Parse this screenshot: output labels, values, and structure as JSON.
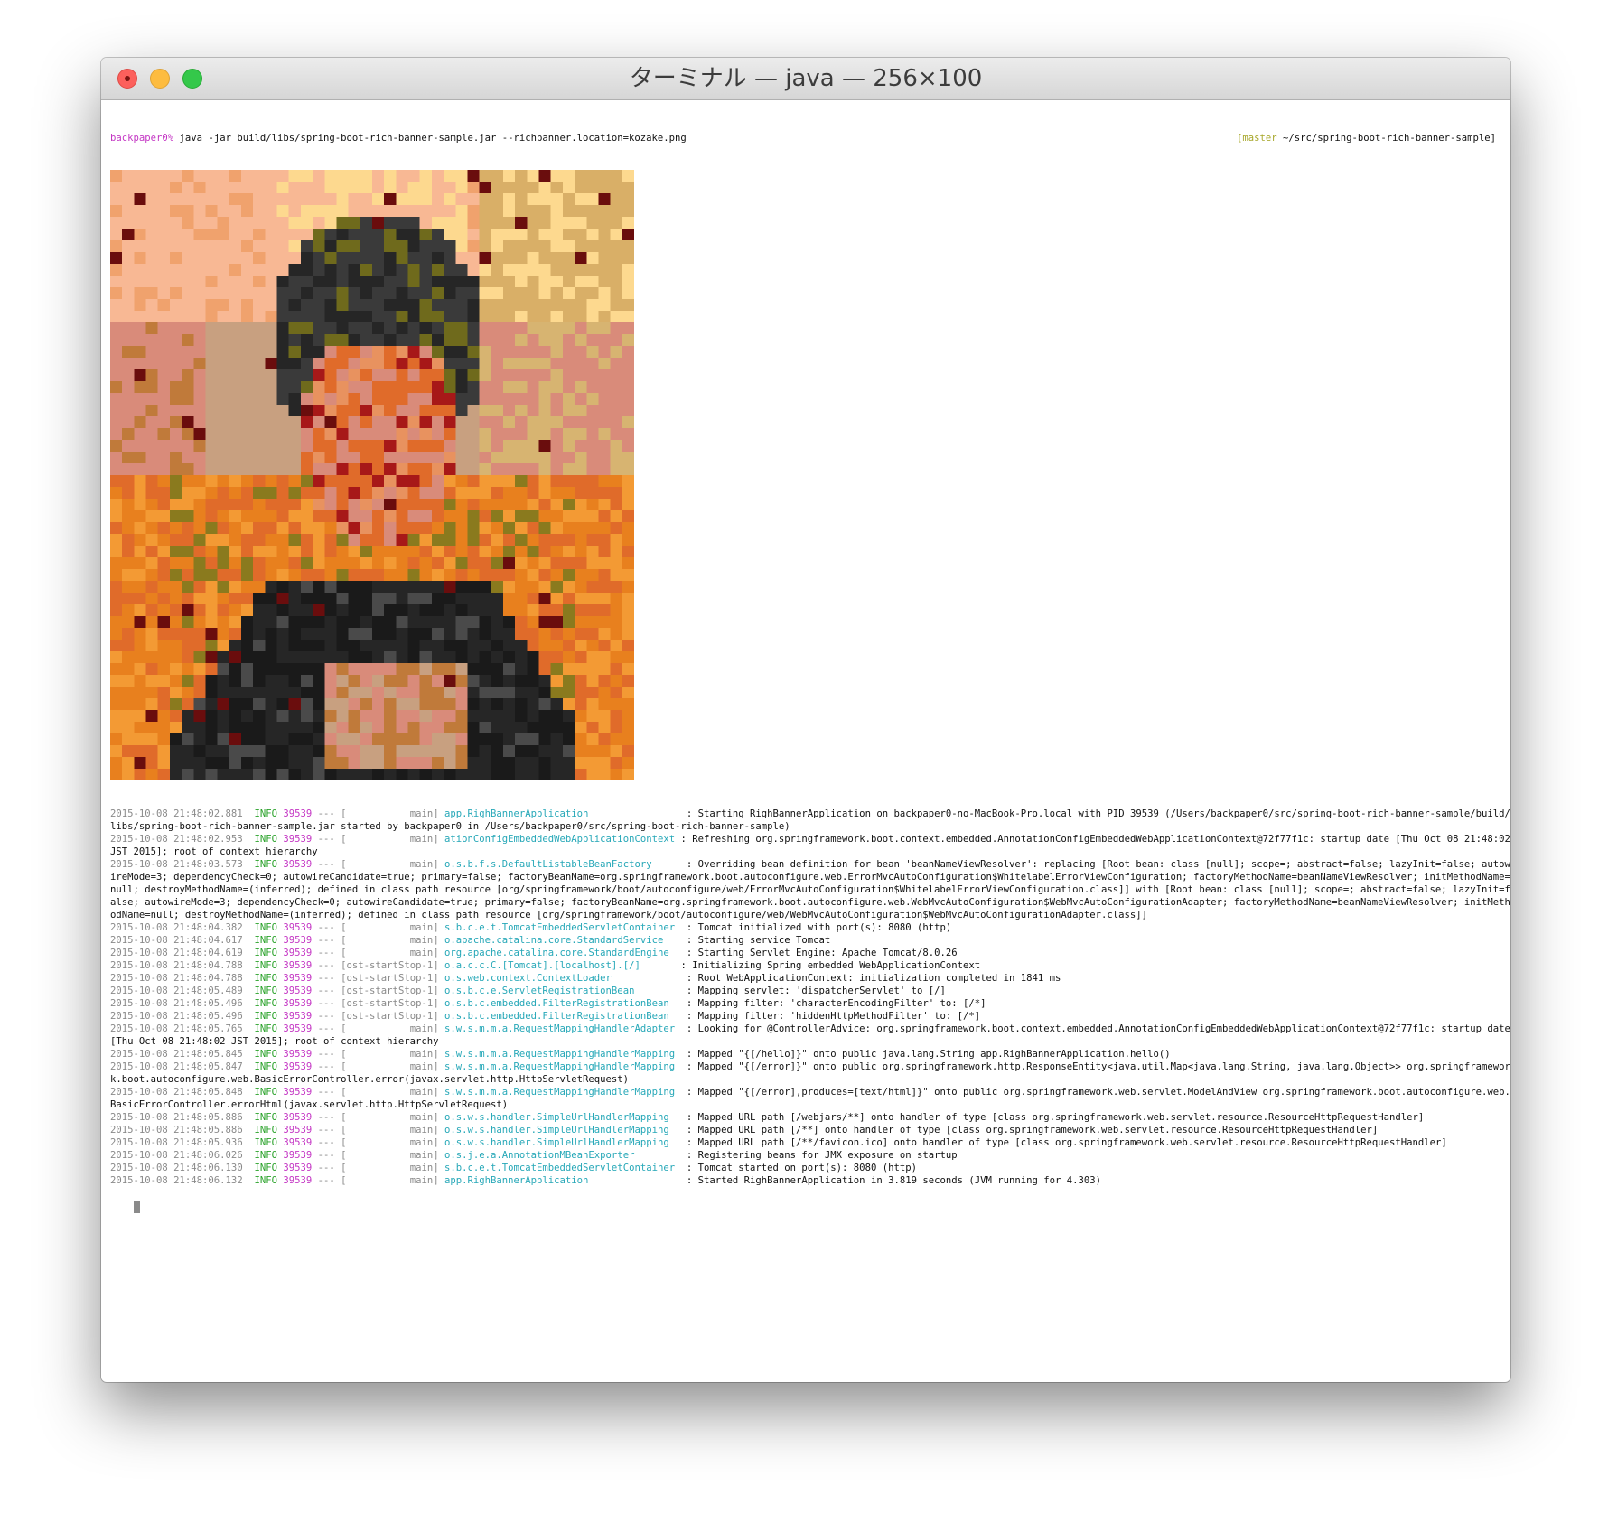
{
  "window": {
    "title": "ターミナル — java — 256×100",
    "buttons": [
      "close",
      "minimize",
      "zoom"
    ]
  },
  "prompt": {
    "user": "backpaper0%",
    "command": " java -jar build/libs/spring-boot-rich-banner-sample.jar --richbanner.location=kozake.png",
    "right_open": "[",
    "branch": "master",
    "path": " ~/src/spring-boot-rich-banner-sample]"
  },
  "banner": {
    "description_icon": "pixelated-portrait-banner-image",
    "palette": [
      "#f8b894",
      "#fdd98f",
      "#d9af67",
      "#d7b471",
      "#f0a26d",
      "#e8925f",
      "#e06b2a",
      "#e8801e",
      "#f39a34",
      "#c07a3a",
      "#b36a2e",
      "#8a7a1e",
      "#6f6a1c",
      "#5b5b18",
      "#3a3a3a",
      "#262626",
      "#1a1a1a",
      "#4a4a4a",
      "#6a0d0d",
      "#a71818",
      "#d98b7a",
      "#c8a080"
    ]
  },
  "logs": [
    {
      "ts": "2015-10-08 21:48:02.881",
      "lvl": "INFO",
      "pid": "39539",
      "sep": "---",
      "thr": "[           main]",
      "logger": "app.RighBannerApplication                ",
      "msg": " : Starting RighBannerApplication on backpaper0-no-MacBook-Pro.local with PID 39539 (/Users/backpaper0/src/spring-boot-rich-banner-sample/build/libs/spring-boot-rich-banner-sample.jar started by backpaper0 in /Users/backpaper0/src/spring-boot-rich-banner-sample)",
      "wrap": true
    },
    {
      "ts": "2015-10-08 21:48:02.953",
      "lvl": "INFO",
      "pid": "39539",
      "sep": "---",
      "thr": "[           main]",
      "logger": "ationConfigEmbeddedWebApplicationContext",
      "msg": " : Refreshing org.springframework.boot.context.embedded.AnnotationConfigEmbeddedWebApplicationContext@72f77f1c: startup date [Thu Oct 08 21:48:02 JST 2015]; root of context hierarchy",
      "wrap": true
    },
    {
      "ts": "2015-10-08 21:48:03.573",
      "lvl": "INFO",
      "pid": "39539",
      "sep": "---",
      "thr": "[           main]",
      "logger": "o.s.b.f.s.DefaultListableBeanFactory     ",
      "msg": " : Overriding bean definition for bean 'beanNameViewResolver': replacing [Root bean: class [null]; scope=; abstract=false; lazyInit=false; autowireMode=3; dependencyCheck=0; autowireCandidate=true; primary=false; factoryBeanName=org.springframework.boot.autoconfigure.web.ErrorMvcAutoConfiguration$WhitelabelErrorViewConfiguration; factoryMethodName=beanNameViewResolver; initMethodName=null; destroyMethodName=(inferred); defined in class path resource [org/springframework/boot/autoconfigure/web/ErrorMvcAutoConfiguration$WhitelabelErrorViewConfiguration.class]] with [Root bean: class [null]; scope=; abstract=false; lazyInit=false; autowireMode=3; dependencyCheck=0; autowireCandidate=true; primary=false; factoryBeanName=org.springframework.boot.autoconfigure.web.WebMvcAutoConfiguration$WebMvcAutoConfigurationAdapter; factoryMethodName=beanNameViewResolver; initMethodName=null; destroyMethodName=(inferred); defined in class path resource [org/springframework/boot/autoconfigure/web/WebMvcAutoConfiguration$WebMvcAutoConfigurationAdapter.class]]",
      "wrap": true
    },
    {
      "ts": "2015-10-08 21:48:04.382",
      "lvl": "INFO",
      "pid": "39539",
      "sep": "---",
      "thr": "[           main]",
      "logger": "s.b.c.e.t.TomcatEmbeddedServletContainer ",
      "msg": " : Tomcat initialized with port(s): 8080 (http)",
      "wrap": false
    },
    {
      "ts": "2015-10-08 21:48:04.617",
      "lvl": "INFO",
      "pid": "39539",
      "sep": "---",
      "thr": "[           main]",
      "logger": "o.apache.catalina.core.StandardService   ",
      "msg": " : Starting service Tomcat",
      "wrap": false
    },
    {
      "ts": "2015-10-08 21:48:04.619",
      "lvl": "INFO",
      "pid": "39539",
      "sep": "---",
      "thr": "[           main]",
      "logger": "org.apache.catalina.core.StandardEngine  ",
      "msg": " : Starting Servlet Engine: Apache Tomcat/8.0.26",
      "wrap": false
    },
    {
      "ts": "2015-10-08 21:48:04.788",
      "lvl": "INFO",
      "pid": "39539",
      "sep": "---",
      "thr": "[ost-startStop-1]",
      "logger": "o.a.c.c.C.[Tomcat].[localhost].[/]      ",
      "msg": " : Initializing Spring embedded WebApplicationContext",
      "wrap": false
    },
    {
      "ts": "2015-10-08 21:48:04.788",
      "lvl": "INFO",
      "pid": "39539",
      "sep": "---",
      "thr": "[ost-startStop-1]",
      "logger": "o.s.web.context.ContextLoader            ",
      "msg": " : Root WebApplicationContext: initialization completed in 1841 ms",
      "wrap": false
    },
    {
      "ts": "2015-10-08 21:48:05.489",
      "lvl": "INFO",
      "pid": "39539",
      "sep": "---",
      "thr": "[ost-startStop-1]",
      "logger": "o.s.b.c.e.ServletRegistrationBean        ",
      "msg": " : Mapping servlet: 'dispatcherServlet' to [/]",
      "wrap": false
    },
    {
      "ts": "2015-10-08 21:48:05.496",
      "lvl": "INFO",
      "pid": "39539",
      "sep": "---",
      "thr": "[ost-startStop-1]",
      "logger": "o.s.b.c.embedded.FilterRegistrationBean  ",
      "msg": " : Mapping filter: 'characterEncodingFilter' to: [/*]",
      "wrap": false
    },
    {
      "ts": "2015-10-08 21:48:05.496",
      "lvl": "INFO",
      "pid": "39539",
      "sep": "---",
      "thr": "[ost-startStop-1]",
      "logger": "o.s.b.c.embedded.FilterRegistrationBean  ",
      "msg": " : Mapping filter: 'hiddenHttpMethodFilter' to: [/*]",
      "wrap": false
    },
    {
      "ts": "2015-10-08 21:48:05.765",
      "lvl": "INFO",
      "pid": "39539",
      "sep": "---",
      "thr": "[           main]",
      "logger": "s.w.s.m.m.a.RequestMappingHandlerAdapter ",
      "msg": " : Looking for @ControllerAdvice: org.springframework.boot.context.embedded.AnnotationConfigEmbeddedWebApplicationContext@72f77f1c: startup date [Thu Oct 08 21:48:02 JST 2015]; root of context hierarchy",
      "wrap": true
    },
    {
      "ts": "2015-10-08 21:48:05.845",
      "lvl": "INFO",
      "pid": "39539",
      "sep": "---",
      "thr": "[           main]",
      "logger": "s.w.s.m.m.a.RequestMappingHandlerMapping ",
      "msg": " : Mapped \"{[/hello]}\" onto public java.lang.String app.RighBannerApplication.hello()",
      "wrap": false
    },
    {
      "ts": "2015-10-08 21:48:05.847",
      "lvl": "INFO",
      "pid": "39539",
      "sep": "---",
      "thr": "[           main]",
      "logger": "s.w.s.m.m.a.RequestMappingHandlerMapping ",
      "msg": " : Mapped \"{[/error]}\" onto public org.springframework.http.ResponseEntity<java.util.Map<java.lang.String, java.lang.Object>> org.springframework.boot.autoconfigure.web.BasicErrorController.error(javax.servlet.http.HttpServletRequest)",
      "wrap": true
    },
    {
      "ts": "2015-10-08 21:48:05.848",
      "lvl": "INFO",
      "pid": "39539",
      "sep": "---",
      "thr": "[           main]",
      "logger": "s.w.s.m.m.a.RequestMappingHandlerMapping ",
      "msg": " : Mapped \"{[/error],produces=[text/html]}\" onto public org.springframework.web.servlet.ModelAndView org.springframework.boot.autoconfigure.web.BasicErrorController.errorHtml(javax.servlet.http.HttpServletRequest)",
      "wrap": true
    },
    {
      "ts": "2015-10-08 21:48:05.886",
      "lvl": "INFO",
      "pid": "39539",
      "sep": "---",
      "thr": "[           main]",
      "logger": "o.s.w.s.handler.SimpleUrlHandlerMapping  ",
      "msg": " : Mapped URL path [/webjars/**] onto handler of type [class org.springframework.web.servlet.resource.ResourceHttpRequestHandler]",
      "wrap": false
    },
    {
      "ts": "2015-10-08 21:48:05.886",
      "lvl": "INFO",
      "pid": "39539",
      "sep": "---",
      "thr": "[           main]",
      "logger": "o.s.w.s.handler.SimpleUrlHandlerMapping  ",
      "msg": " : Mapped URL path [/**] onto handler of type [class org.springframework.web.servlet.resource.ResourceHttpRequestHandler]",
      "wrap": false
    },
    {
      "ts": "2015-10-08 21:48:05.936",
      "lvl": "INFO",
      "pid": "39539",
      "sep": "---",
      "thr": "[           main]",
      "logger": "o.s.w.s.handler.SimpleUrlHandlerMapping  ",
      "msg": " : Mapped URL path [/**/favicon.ico] onto handler of type [class org.springframework.web.servlet.resource.ResourceHttpRequestHandler]",
      "wrap": false
    },
    {
      "ts": "2015-10-08 21:48:06.026",
      "lvl": "INFO",
      "pid": "39539",
      "sep": "---",
      "thr": "[           main]",
      "logger": "o.s.j.e.a.AnnotationMBeanExporter        ",
      "msg": " : Registering beans for JMX exposure on startup",
      "wrap": false
    },
    {
      "ts": "2015-10-08 21:48:06.130",
      "lvl": "INFO",
      "pid": "39539",
      "sep": "---",
      "thr": "[           main]",
      "logger": "s.b.c.e.t.TomcatEmbeddedServletContainer ",
      "msg": " : Tomcat started on port(s): 8080 (http)",
      "wrap": false
    },
    {
      "ts": "2015-10-08 21:48:06.132",
      "lvl": "INFO",
      "pid": "39539",
      "sep": "---",
      "thr": "[           main]",
      "logger": "app.RighBannerApplication                ",
      "msg": " : Started RighBannerApplication in 3.819 seconds (JVM running for 4.303)",
      "wrap": false
    }
  ]
}
